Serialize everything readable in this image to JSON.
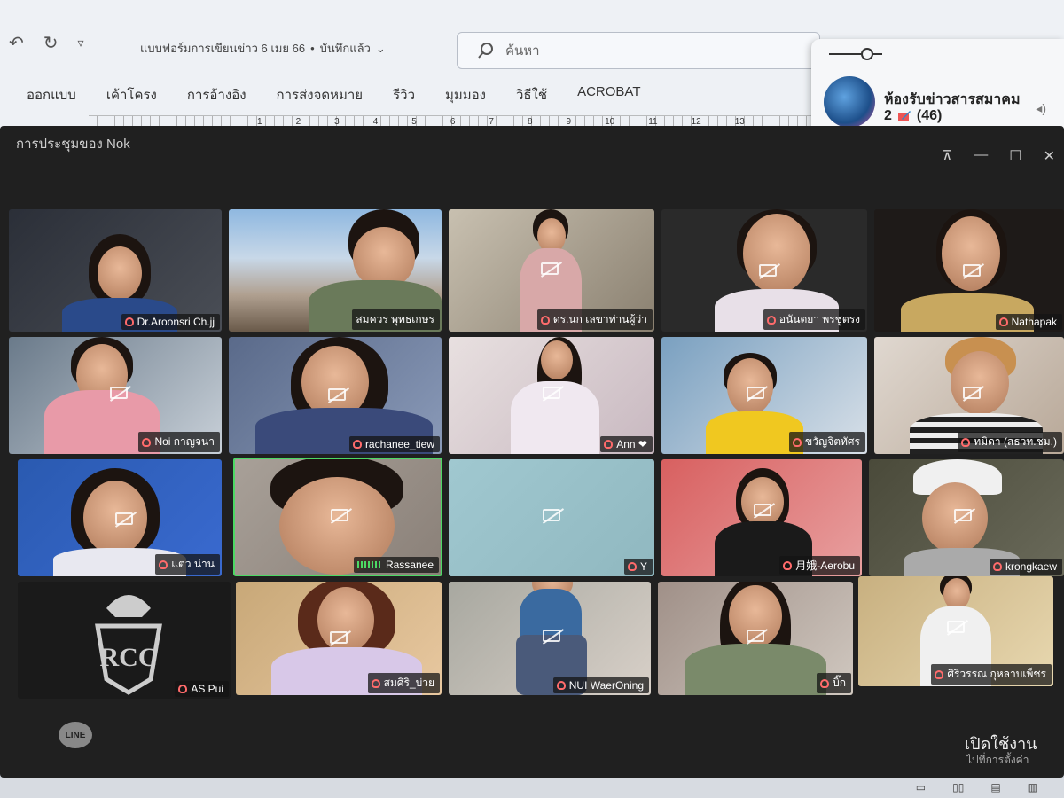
{
  "word": {
    "qat": {
      "undo": "↶",
      "redo": "↻",
      "more": "▿"
    },
    "doc_title": "แบบฟอร์มการเขียนข่าว 6 เมย 66",
    "doc_sep": "•",
    "doc_status": "บันทึกแล้ว",
    "search_placeholder": "ค้นหา",
    "tabs": [
      "ออกแบบ",
      "เค้าโครง",
      "การอ้างอิง",
      "การส่งจดหมาย",
      "รีวิว",
      "มุมมอง",
      "วิธีใช้",
      "ACROBAT"
    ],
    "ruler_numbers": [
      "1",
      "2",
      "3",
      "4",
      "5",
      "6",
      "7",
      "8",
      "9",
      "10",
      "11",
      "12",
      "13"
    ]
  },
  "notification": {
    "group_name": "ห้องรับข่าวสารสมาคม",
    "count_left": "2",
    "count_total": "(46)"
  },
  "meeting": {
    "title": "การประชุมของ Nok",
    "controls": {
      "pin": "⊼",
      "minimize": "—",
      "maximize": "☐",
      "close": "✕"
    },
    "participants": [
      {
        "name": "Dr.Aroonsri Ch.jj"
      },
      {
        "name": "สมควร พุทธเกษร"
      },
      {
        "name": "ดร.นก เลขาท่านผู้ว่า"
      },
      {
        "name": "อนันตยา พรชูตรง"
      },
      {
        "name": "Nathapak"
      },
      {
        "name": "Noi กาญจนา"
      },
      {
        "name": "rachanee_tiew"
      },
      {
        "name": "Ann ❤"
      },
      {
        "name": "ขวัญจิตทัศร"
      },
      {
        "name": "ทมิดา (สธวท.ชม.)"
      },
      {
        "name": "แตว น่าน"
      },
      {
        "name": "Rassanee"
      },
      {
        "name": "Y"
      },
      {
        "name": "月娥-Aerobu"
      },
      {
        "name": "krongkaew"
      },
      {
        "name": "AS Pui"
      },
      {
        "name": "สมศิริ_บ่วย"
      },
      {
        "name": "NUI WaerOning"
      },
      {
        "name": "บิ๊ก"
      },
      {
        "name": "ศิริวรรณ กุหลาบเพ็ชร"
      }
    ],
    "logo_text": "LINE",
    "watermark": "เปิดใช้งาน",
    "watermark_sub": "ไปที่การตั้งค่า"
  },
  "colors": {
    "speaking": "#4cd964",
    "notif_bg": "#f6f7f9",
    "meeting_bg": "#202020"
  }
}
